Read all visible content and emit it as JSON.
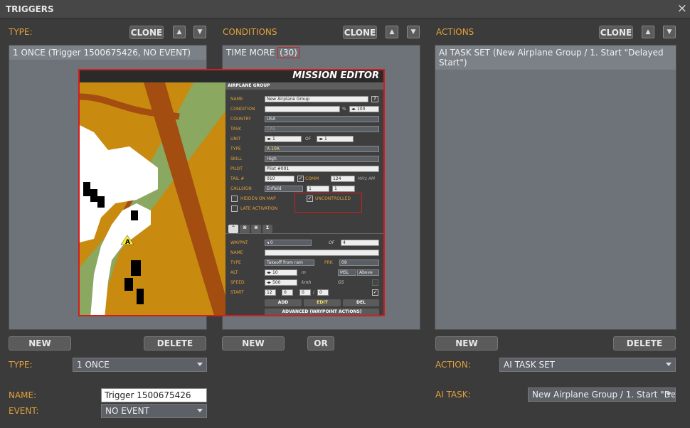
{
  "window": {
    "title": "TRIGGERS",
    "close_icon": "×"
  },
  "columns": {
    "type": {
      "header": "TYPE:",
      "clone": "CLONE",
      "items": [
        "1 ONCE (Trigger 1500675426, NO EVENT)"
      ]
    },
    "conditions": {
      "header": "CONDITIONS",
      "clone": "CLONE",
      "item_text": "TIME MORE",
      "item_value": "(30)"
    },
    "actions": {
      "header": "ACTIONS",
      "clone": "CLONE",
      "items": [
        "AI TASK SET (New Airplane Group / 1. Start \"Delayed Start\")"
      ]
    }
  },
  "buttons": {
    "new": "NEW",
    "delete": "DELETE",
    "or": "OR"
  },
  "bottom": {
    "type_label": "TYPE:",
    "type_value": "1 ONCE",
    "name_label": "NAME:",
    "name_value": "Trigger 1500675426",
    "event_label": "EVENT:",
    "event_value": "NO EVENT",
    "action_label": "ACTION:",
    "action_value": "AI TASK SET",
    "ai_task_label": "AI TASK:",
    "ai_task_value": "New Airplane Group / 1. Start \"Dela"
  },
  "mission_editor": {
    "title": "MISSION EDITOR",
    "marker": "A",
    "panel": {
      "header": "AIRPLANE GROUP",
      "help": "?",
      "name_label": "NAME",
      "name_value": "New Airplane Group",
      "condition_label": "CONDITION",
      "condition_pct": "%",
      "condition_value": "100",
      "country_label": "COUNTRY",
      "country_value": "USA",
      "task_label": "TASK",
      "task_value": "CAS",
      "unit_label": "UNIT",
      "unit_value": "1",
      "unit_of": "OF",
      "unit_total": "1",
      "type_label": "TYPE",
      "type_value": "A-10A",
      "skill_label": "SKILL",
      "skill_value": "High",
      "pilot_label": "PILOT",
      "pilot_value": "Pilot #001",
      "tail_label": "TAIL #",
      "tail_value": "010",
      "comm_label": "COMM",
      "comm_value": "124",
      "comm_unit": "MHz AM",
      "callsign_label": "CALLSIGN",
      "callsign_value": "Enfield",
      "callsign_n1": "1",
      "callsign_n2": "1",
      "hidden_label": "HIDDEN ON MAP",
      "uncontrolled_label": "UNCONTROLLED",
      "late_label": "LATE ACTIVATION",
      "tabs": [
        "^",
        "⌘",
        "⌘",
        "Σ"
      ],
      "waypnt_label": "WAYPNT",
      "waypnt_value": "0",
      "waypnt_of": "OF",
      "waypnt_total": "4",
      "wname_label": "NAME",
      "wtype_label": "TYPE",
      "wtype_value": "Takeoff from ram",
      "prk_label": "PRK",
      "prk_value": "09",
      "alt_label": "ALT",
      "alt_value": "10",
      "alt_unit": "m",
      "alt_ref": "MSL",
      "alt_above": "Above",
      "speed_label": "SPEED",
      "speed_value": "500",
      "speed_unit": "kmh",
      "gs_label": "GS",
      "start_label": "START",
      "start_h": "12",
      "start_m": "0",
      "start_s": "0",
      "start_sep": "/",
      "start_d": "0",
      "add": "ADD",
      "edit": "EDIT",
      "del": "DEL",
      "advanced": "ADVANCED (WAYPOINT ACTIONS)"
    }
  }
}
